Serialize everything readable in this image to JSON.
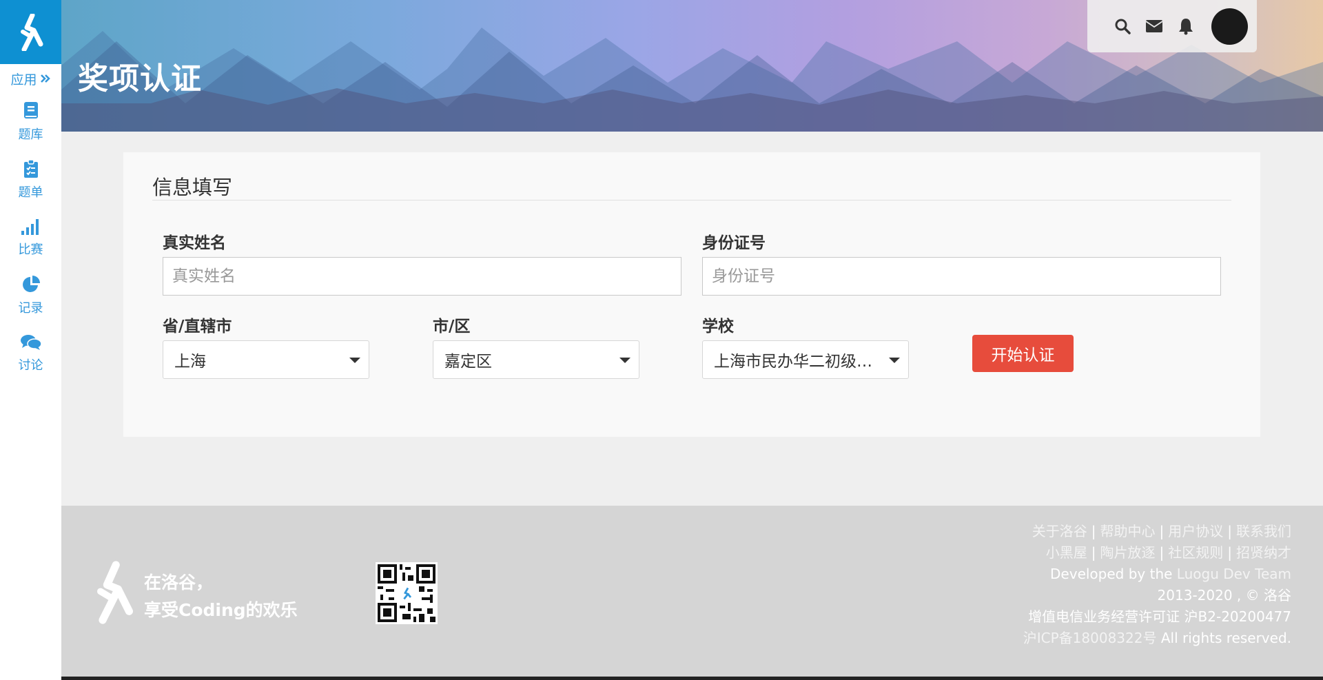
{
  "sidebar": {
    "apps_label": "应用",
    "items": [
      {
        "label": "题库",
        "icon": "book-icon"
      },
      {
        "label": "题单",
        "icon": "clipboard-icon"
      },
      {
        "label": "比赛",
        "icon": "signal-bars-icon"
      },
      {
        "label": "记录",
        "icon": "pie-chart-icon"
      },
      {
        "label": "讨论",
        "icon": "comments-icon"
      }
    ]
  },
  "header": {
    "title": "奖项认证",
    "icons": [
      "search-icon",
      "envelope-icon",
      "bell-icon"
    ]
  },
  "form": {
    "section_title": "信息填写",
    "name_label": "真实姓名",
    "name_placeholder": "真实姓名",
    "name_value": "",
    "id_label": "身份证号",
    "id_placeholder": "身份证号",
    "id_value": "",
    "province_label": "省/直辖市",
    "province_value": "上海",
    "city_label": "市/区",
    "city_value": "嘉定区",
    "school_label": "学校",
    "school_value": "上海市民办华二初级中学",
    "submit_label": "开始认证"
  },
  "footer": {
    "slogan_line1": "在洛谷，",
    "slogan_line2": "享受Coding的欢乐",
    "links_row1": [
      "关于洛谷",
      "帮助中心",
      "用户协议",
      "联系我们"
    ],
    "links_row2": [
      "小黑屋",
      "陶片放逐",
      "社区规则",
      "招贤纳才"
    ],
    "developed_prefix": "Developed by the ",
    "developed_team": "Luogu Dev Team",
    "copyright": "2013-2020 , © 洛谷",
    "license": "增值电信业务经营许可证 沪B2-20200477",
    "icp_link": "沪ICP备18008322号",
    "rights": " All rights reserved."
  },
  "colors": {
    "brand_blue": "#0e90d2",
    "nav_blue": "#3498db",
    "submit_red": "#e74c3c"
  }
}
